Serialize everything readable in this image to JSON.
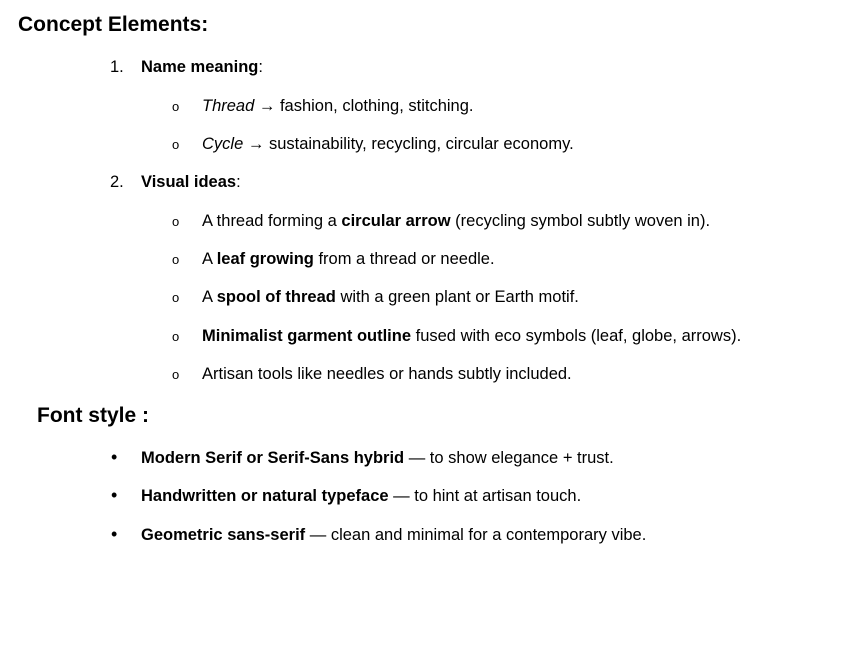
{
  "concept": {
    "heading": "Concept Elements:",
    "items": [
      {
        "number": "1.",
        "title": "Name meaning",
        "suffix": ":",
        "subitems": [
          {
            "term": "Thread",
            "arrow": " → ",
            "text": "fashion, clothing, stitching."
          },
          {
            "term": "Cycle",
            "arrow": " → ",
            "text": "sustainability, recycling, circular economy."
          }
        ]
      },
      {
        "number": "2.",
        "title": "Visual ideas",
        "suffix": ":",
        "subitems": [
          {
            "pre": "A thread forming a ",
            "bold": "circular arrow",
            "post": " (recycling symbol subtly woven in)."
          },
          {
            "pre": "A ",
            "bold": "leaf growing",
            "post": " from a thread or needle."
          },
          {
            "pre": "A ",
            "bold": "spool of thread",
            "post": " with a green plant or Earth motif."
          },
          {
            "pre": "",
            "bold": "Minimalist garment outline",
            "post": " fused with eco symbols (leaf, globe, arrows)."
          },
          {
            "pre": "Artisan tools like needles or hands subtly included.",
            "bold": "",
            "post": ""
          }
        ]
      }
    ],
    "sub_bullet": "o"
  },
  "font_style": {
    "heading": "Font style :",
    "bullet": "•",
    "items": [
      {
        "bold": "Modern Serif or Serif-Sans hybrid",
        "rest": " — to show elegance + trust."
      },
      {
        "bold": "Handwritten or natural typeface",
        "rest": " — to hint at artisan touch."
      },
      {
        "bold": "Geometric sans-serif",
        "rest": " — clean and minimal for a contemporary vibe."
      }
    ]
  }
}
